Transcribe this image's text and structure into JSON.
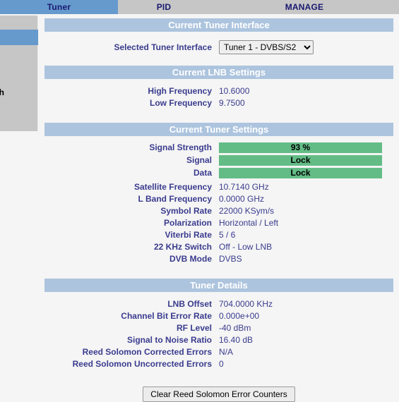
{
  "tabs": [
    {
      "label": "Tuner",
      "name": "tab-tuner",
      "active": true
    },
    {
      "label": "PID",
      "name": "tab-pid",
      "active": false
    },
    {
      "label": "MANAGE",
      "name": "tab-manage",
      "active": false
    }
  ],
  "sidebar": {
    "selected_item_label": "",
    "refresh_item_label": "sh"
  },
  "sections": {
    "tuner_interface": {
      "title": "Current Tuner Interface",
      "selected_label": "Selected Tuner Interface",
      "selected_value": "Tuner 1 - DVBS/S2",
      "options": [
        "Tuner 1 - DVBS/S2"
      ]
    },
    "lnb": {
      "title": "Current LNB Settings",
      "rows": [
        {
          "label": "High Frequency",
          "value": "10.6000"
        },
        {
          "label": "Low Frequency",
          "value": "9.7500"
        }
      ]
    },
    "tuner_settings": {
      "title": "Current Tuner Settings",
      "bars": [
        {
          "label": "Signal Strength",
          "value": "93 %"
        },
        {
          "label": "Signal",
          "value": "Lock"
        },
        {
          "label": "Data",
          "value": "Lock"
        }
      ],
      "rows": [
        {
          "label": "Satellite Frequency",
          "value": "10.7140 GHz"
        },
        {
          "label": "L Band Frequency",
          "value": "0.0000 GHz"
        },
        {
          "label": "Symbol Rate",
          "value": "22000 KSym/s"
        },
        {
          "label": "Polarization",
          "value": "Horizontal / Left"
        },
        {
          "label": "Viterbi Rate",
          "value": "5 / 6"
        },
        {
          "label": "22 KHz Switch",
          "value": "Off - Low LNB"
        },
        {
          "label": "DVB Mode",
          "value": "DVBS"
        }
      ]
    },
    "tuner_details": {
      "title": "Tuner Details",
      "rows": [
        {
          "label": "LNB Offset",
          "value": "704.0000 KHz"
        },
        {
          "label": "Channel Bit Error Rate",
          "value": "0.000e+00"
        },
        {
          "label": "RF Level",
          "value": "-40 dBm"
        },
        {
          "label": "Signal to Noise Ratio",
          "value": "16.40 dB"
        },
        {
          "label": "Reed Solomon Corrected Errors",
          "value": "N/A"
        },
        {
          "label": "Reed Solomon Uncorrected Errors",
          "value": "0"
        }
      ]
    }
  },
  "footer": {
    "clear_button_label": "Clear Reed Solomon Error Counters"
  },
  "colors": {
    "tab_active": "#6699cc",
    "tab_bar": "#c6c6c6",
    "section_header": "#adc4de",
    "status_green": "#63bc86",
    "label_blue": "#3b3b8f",
    "page_bg": "#f4f5f4"
  }
}
